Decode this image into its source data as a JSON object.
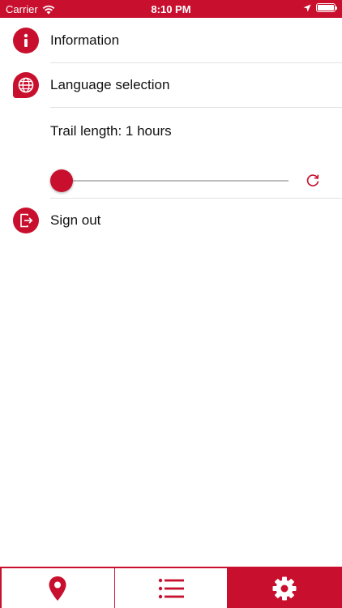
{
  "status_bar": {
    "carrier": "Carrier",
    "time": "8:10 PM",
    "battery_level": 1.0
  },
  "menu": {
    "information_label": "Information",
    "language_label": "Language selection",
    "trail_length_label": "Trail length: 1 hours",
    "trail_length_value": 0,
    "sign_out_label": "Sign out"
  },
  "tabs": [
    {
      "name": "map",
      "icon": "map-pin-icon",
      "active": false
    },
    {
      "name": "list",
      "icon": "list-icon",
      "active": false
    },
    {
      "name": "settings",
      "icon": "gear-icon",
      "active": true
    }
  ],
  "colors": {
    "accent": "#c8102e",
    "divider": "#e2e2e2",
    "track": "#bdbdbd"
  }
}
